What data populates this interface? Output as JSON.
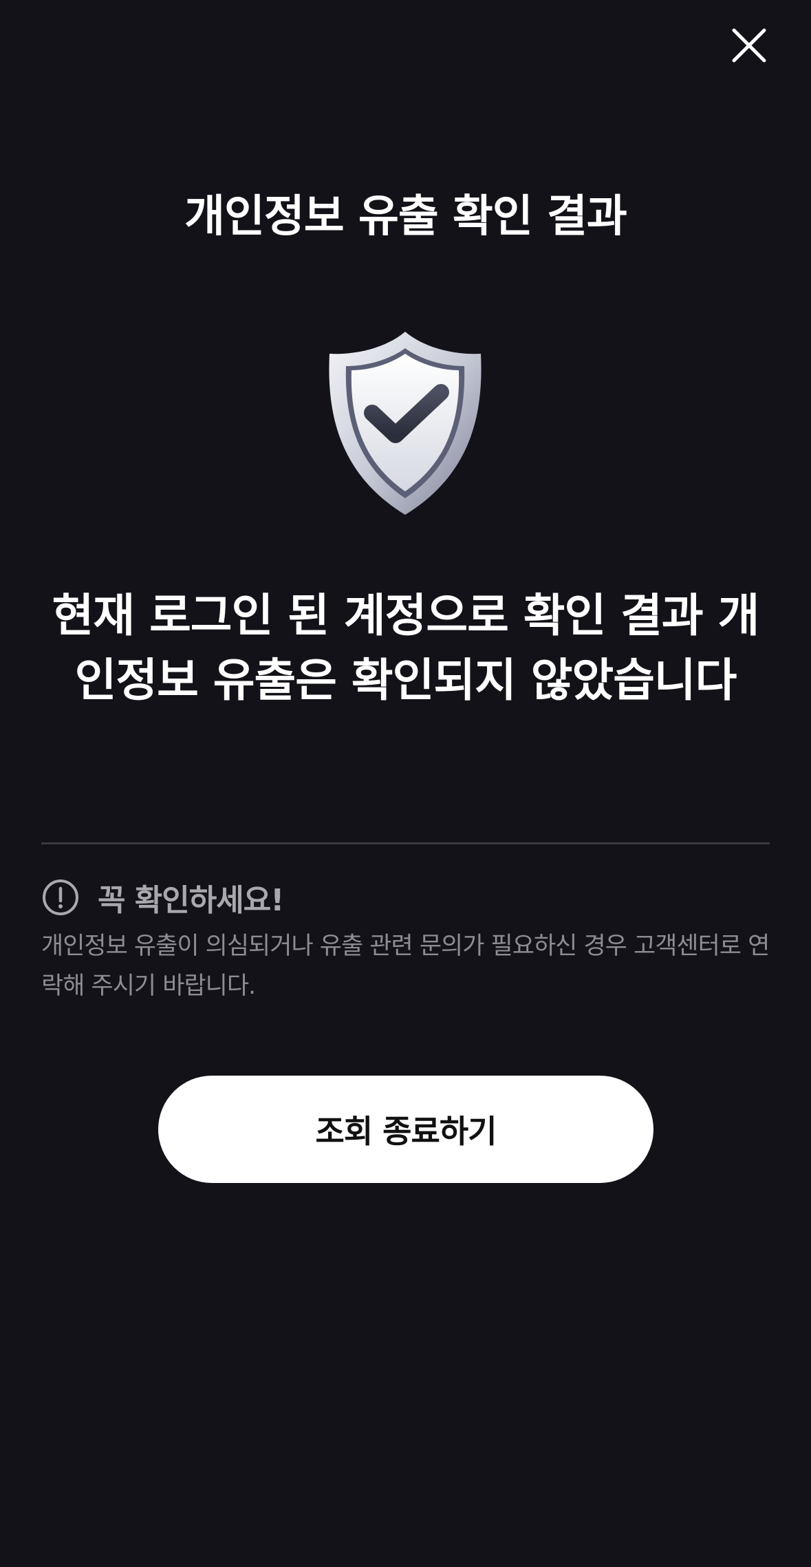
{
  "header": {
    "close_icon": "close-icon"
  },
  "title": "개인정보 유출 확인 결과",
  "illustration": {
    "icon": "shield-check-icon"
  },
  "result": {
    "message": "현재 로그인 된 계정으로 확인 결과 개인정보 유출은 확인되지 않았습니다"
  },
  "notice": {
    "icon": "alert-circle-icon",
    "title": "꼭 확인하세요!",
    "body": "개인정보 유출이 의심되거나 유출 관련 문의가 필요하신 경우 고객센터로 연락해 주시기 바랍니다."
  },
  "actions": {
    "end_query_label": "조회 종료하기"
  },
  "colors": {
    "background": "#131218",
    "primary_text": "#ffffff",
    "secondary_text": "#8d8c92",
    "button_bg": "#ffffff",
    "button_text": "#111111"
  }
}
